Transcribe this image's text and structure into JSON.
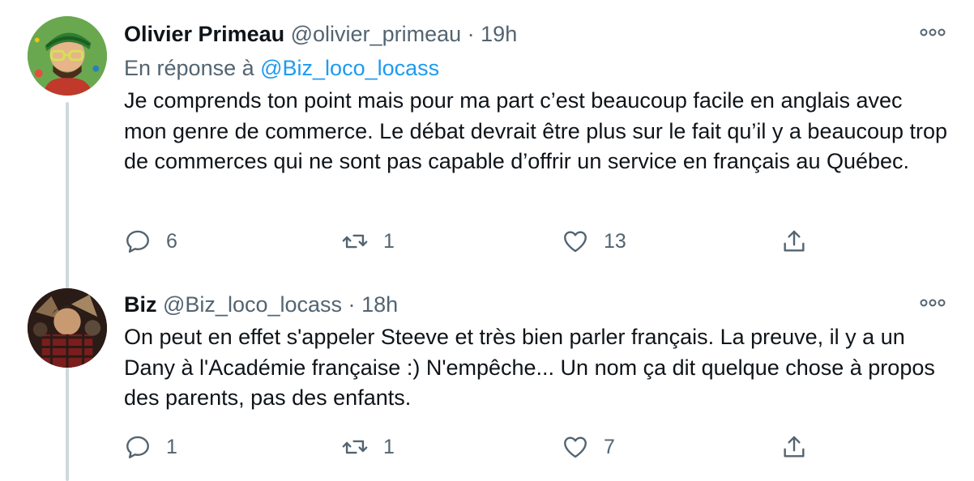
{
  "tweets": [
    {
      "author_name": "Olivier Primeau",
      "handle": "@olivier_primeau",
      "separator": "·",
      "time": "19h",
      "reply_prefix": "En réponse à ",
      "reply_handle": "@Biz_loco_locass",
      "text": "Je comprends ton point mais pour ma part c’est beaucoup facile en anglais avec mon genre de commerce. Le débat devrait être plus sur le fait qu’il y a beaucoup trop de commerces qui ne sont pas capable d’offrir un service en français au Québec.",
      "replies": "6",
      "retweets": "1",
      "likes": "13"
    },
    {
      "author_name": "Biz",
      "handle": "@Biz_loco_locass",
      "separator": "·",
      "time": "18h",
      "text": "On peut en effet s'appeler Steeve et très bien parler français. La preuve, il y a un Dany à l'Académie française :) N'empêche... Un nom ça dit quelque chose à propos des parents, pas des enfants.",
      "replies": "1",
      "retweets": "1",
      "likes": "7"
    }
  ],
  "icons": {
    "reply": "reply-icon",
    "retweet": "retweet-icon",
    "like": "heart-icon",
    "share": "share-icon",
    "more": "more-icon"
  },
  "colors": {
    "link": "#1d9bf0",
    "muted": "#536471",
    "thread_line": "#cfd9de"
  }
}
